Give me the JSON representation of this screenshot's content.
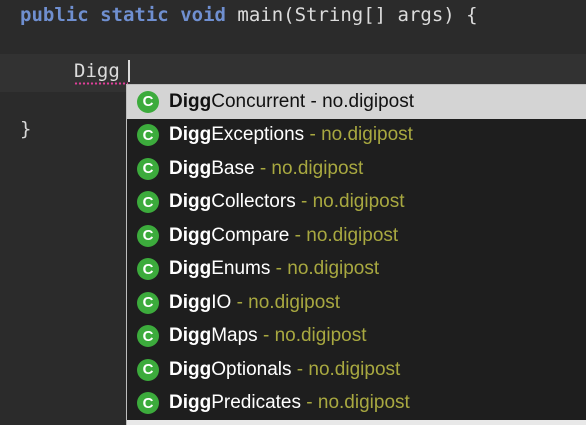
{
  "editor": {
    "line1": {
      "kw1": "public",
      "kw2": "static",
      "kw3": "void",
      "rest": "main(String[] args) {"
    },
    "typed_text": "Digg",
    "closing_brace": "}"
  },
  "autocomplete": {
    "match_prefix": "Digg",
    "separator": "-",
    "items": [
      {
        "icon": "class-icon",
        "badge": "C",
        "suffix": "Concurrent",
        "package": "no.digipost",
        "selected": true
      },
      {
        "icon": "class-icon",
        "badge": "C",
        "suffix": "Exceptions",
        "package": "no.digipost",
        "selected": false
      },
      {
        "icon": "class-icon",
        "badge": "C",
        "suffix": "Base",
        "package": "no.digipost",
        "selected": false
      },
      {
        "icon": "class-icon",
        "badge": "C",
        "suffix": "Collectors",
        "package": "no.digipost",
        "selected": false
      },
      {
        "icon": "class-icon",
        "badge": "C",
        "suffix": "Compare",
        "package": "no.digipost",
        "selected": false
      },
      {
        "icon": "class-icon",
        "badge": "C",
        "suffix": "Enums",
        "package": "no.digipost",
        "selected": false
      },
      {
        "icon": "class-icon",
        "badge": "C",
        "suffix": "IO",
        "package": "no.digipost",
        "selected": false
      },
      {
        "icon": "class-icon",
        "badge": "C",
        "suffix": "Maps",
        "package": "no.digipost",
        "selected": false
      },
      {
        "icon": "class-icon",
        "badge": "C",
        "suffix": "Optionals",
        "package": "no.digipost",
        "selected": false
      },
      {
        "icon": "class-icon",
        "badge": "C",
        "suffix": "Predicates",
        "package": "no.digipost",
        "selected": false
      }
    ]
  },
  "colors": {
    "editor_bg": "#2b2b2b",
    "keyword": "#6f8fd0",
    "popup_bg": "#1e1e1e",
    "selected_bg": "#d4d4d4",
    "class_badge": "#3cab3c",
    "package_text": "#a8a840",
    "squiggle": "#e0409a"
  }
}
